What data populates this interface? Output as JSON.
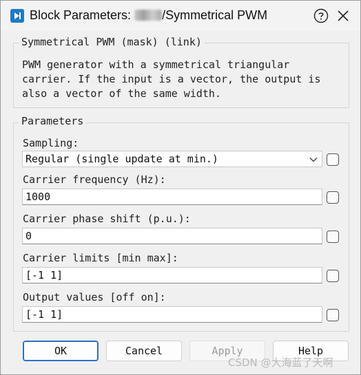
{
  "window": {
    "title_prefix": "Block Parameters: ",
    "title_suffix": "/Symmetrical PWM"
  },
  "description_group": {
    "title": "Symmetrical PWM (mask) (link)",
    "text": "PWM generator with a symmetrical triangular\ncarrier. If the input is a vector, the output is\nalso a vector of the same width."
  },
  "parameters_group": {
    "title": "Parameters",
    "sampling": {
      "label": "Sampling:",
      "value": "Regular (single update at min.)"
    },
    "carrier_frequency": {
      "label": "Carrier frequency (Hz):",
      "value": "1000"
    },
    "carrier_phase_shift": {
      "label": "Carrier phase shift (p.u.):",
      "value": "0"
    },
    "carrier_limits": {
      "label": "Carrier limits [min max]:",
      "value": "[-1 1]"
    },
    "output_values": {
      "label": "Output values [off on]:",
      "value": "[-1 1]"
    }
  },
  "buttons": {
    "ok": "OK",
    "cancel": "Cancel",
    "apply": "Apply",
    "help": "Help"
  },
  "watermark": "CSDN @大海蓝了天啊",
  "colors": {
    "app_icon": "#1f7ac8",
    "default_button_border": "#2b6fc7",
    "disabled_text": "#9b9b9b"
  },
  "icons": {
    "app": "simulink-block-icon",
    "help": "help-circle-icon",
    "close": "close-icon",
    "dropdown": "chevron-down-icon"
  }
}
